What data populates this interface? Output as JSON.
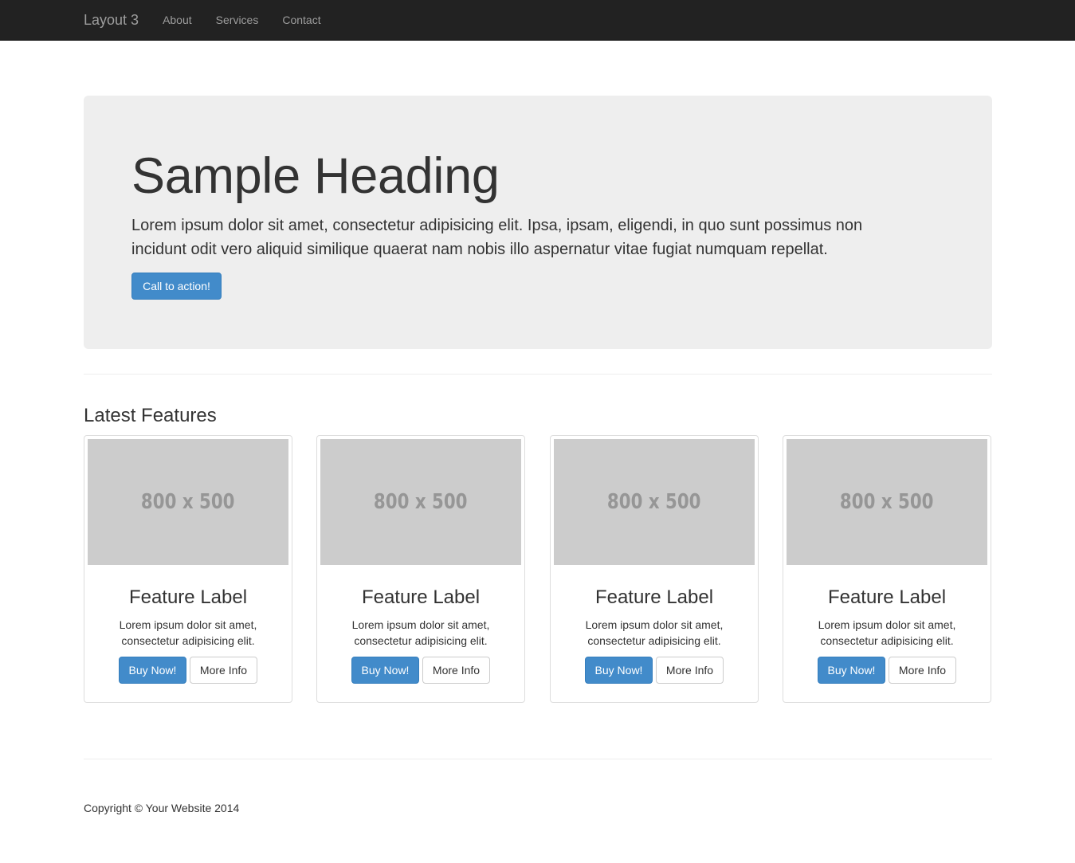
{
  "navbar": {
    "brand": "Layout 3",
    "links": [
      "About",
      "Services",
      "Contact"
    ]
  },
  "hero": {
    "heading": "Sample Heading",
    "text": "Lorem ipsum dolor sit amet, consectetur adipisicing elit. Ipsa, ipsam, eligendi, in quo sunt possimus non incidunt odit vero aliquid similique quaerat nam nobis illo aspernatur vitae fugiat numquam repellat.",
    "cta_label": "Call to action!"
  },
  "features": {
    "title": "Latest Features",
    "items": [
      {
        "image_label": "800 x 500",
        "label": "Feature Label",
        "text": "Lorem ipsum dolor sit amet, consectetur adipisicing elit.",
        "buy_label": "Buy Now!",
        "info_label": "More Info"
      },
      {
        "image_label": "800 x 500",
        "label": "Feature Label",
        "text": "Lorem ipsum dolor sit amet, consectetur adipisicing elit.",
        "buy_label": "Buy Now!",
        "info_label": "More Info"
      },
      {
        "image_label": "800 x 500",
        "label": "Feature Label",
        "text": "Lorem ipsum dolor sit amet, consectetur adipisicing elit.",
        "buy_label": "Buy Now!",
        "info_label": "More Info"
      },
      {
        "image_label": "800 x 500",
        "label": "Feature Label",
        "text": "Lorem ipsum dolor sit amet, consectetur adipisicing elit.",
        "buy_label": "Buy Now!",
        "info_label": "More Info"
      }
    ]
  },
  "footer": {
    "copyright": "Copyright © Your Website 2014"
  },
  "colors": {
    "navbar_bg": "#222222",
    "jumbotron_bg": "#eeeeee",
    "primary": "#428bca",
    "placeholder": "#cccccc"
  }
}
